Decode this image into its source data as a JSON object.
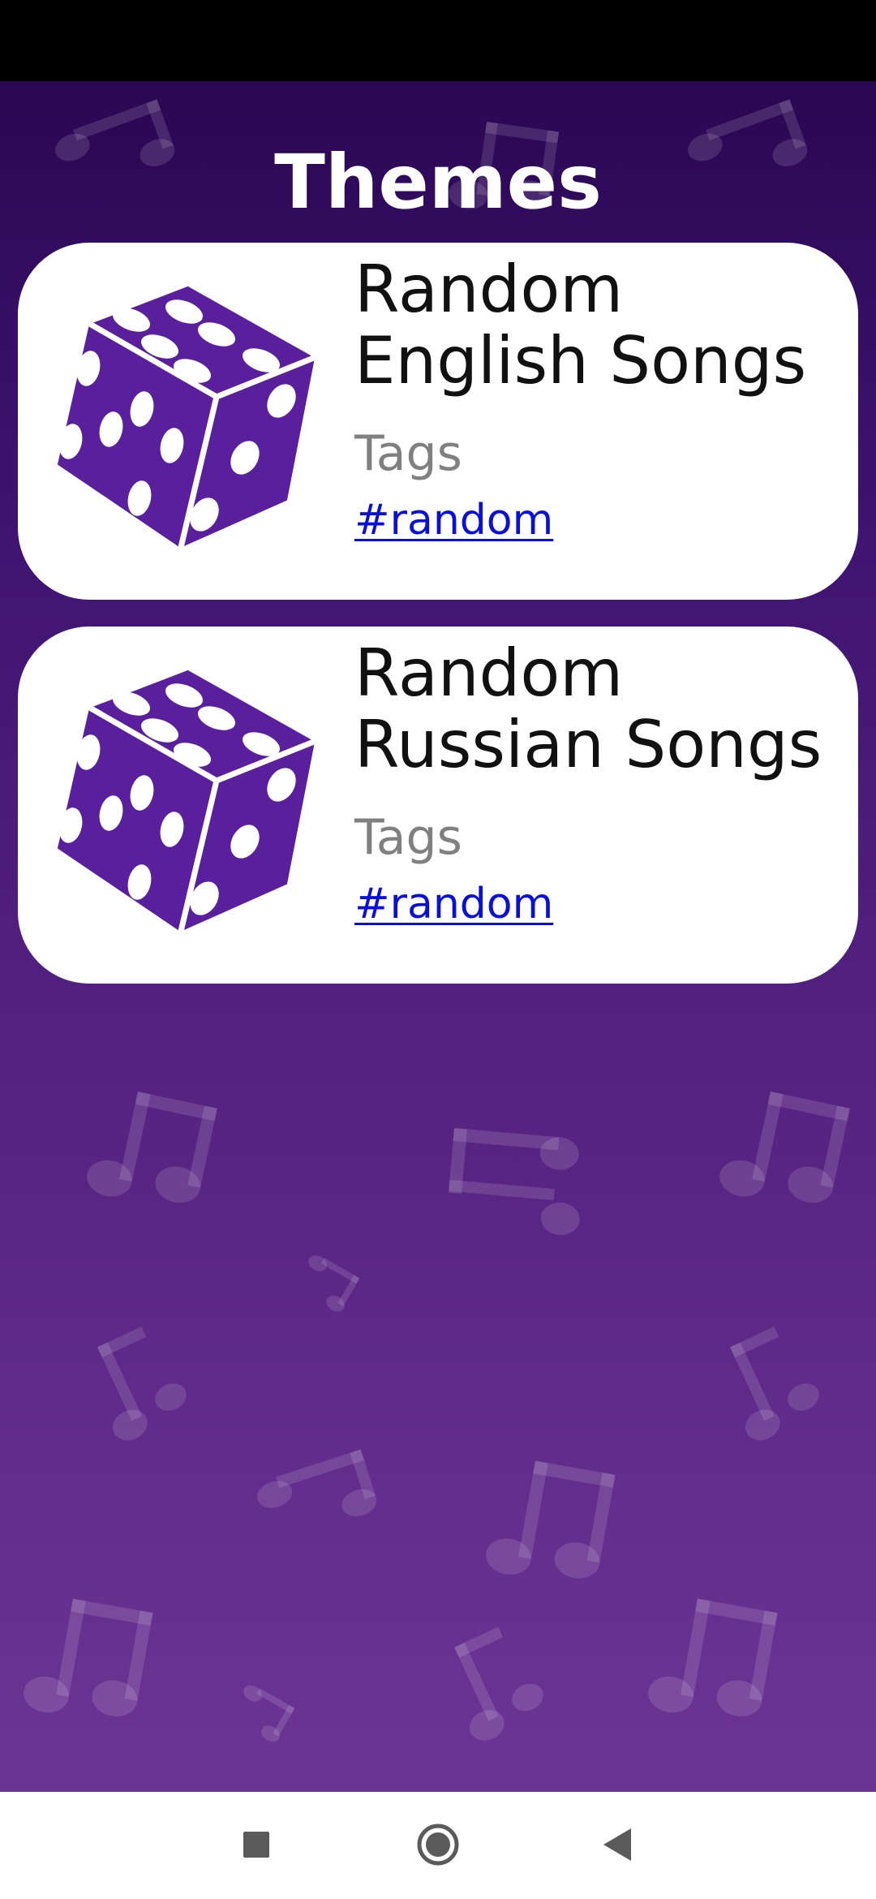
{
  "header": {
    "title": "Themes"
  },
  "themes": [
    {
      "title_line1": "Random",
      "title_line2": "English Songs",
      "tags_label": "Tags",
      "tag": "#random",
      "icon": "dice-icon"
    },
    {
      "title_line1": "Random",
      "title_line2": "Russian Songs",
      "tags_label": "Tags",
      "tag": "#random",
      "icon": "dice-icon"
    }
  ],
  "navigation": {
    "icons": [
      "recents-square-icon",
      "home-circle-icon",
      "back-triangle-icon"
    ]
  },
  "colors": {
    "background_top": "#2b0753",
    "background_bottom": "#6c3594",
    "dice": "#5a1f9c",
    "link": "#0a10d8",
    "tags_label": "#808080"
  }
}
